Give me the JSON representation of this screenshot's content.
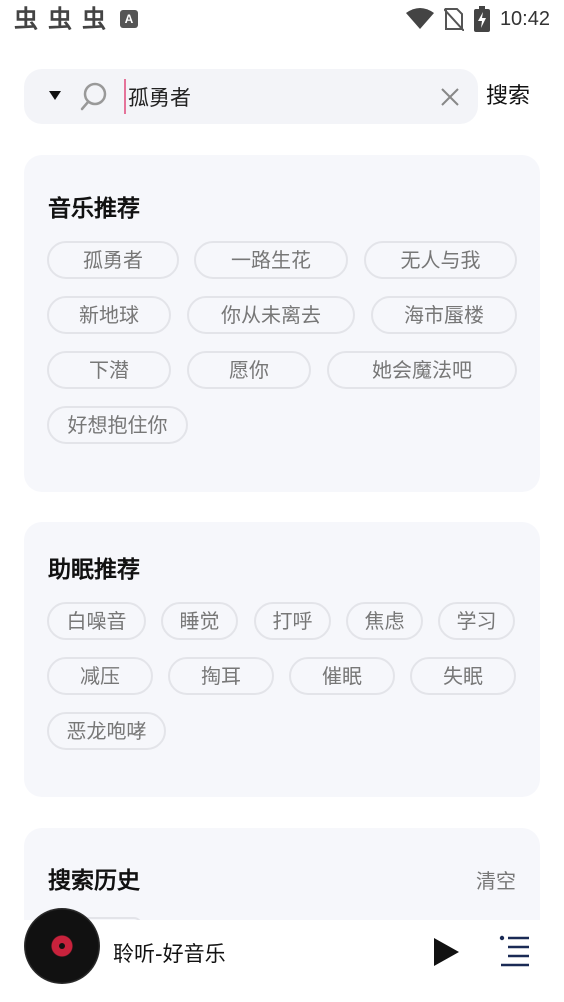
{
  "status_bar": {
    "time": "10:42",
    "left_icons": [
      "bug-icon",
      "bug-icon",
      "bug-icon",
      "a-badge-icon"
    ],
    "a_badge": "A",
    "right_icons": [
      "wifi-icon",
      "no-sim-icon",
      "battery-charging-icon"
    ]
  },
  "search": {
    "value": "孤勇者",
    "button_label": "搜索"
  },
  "music": {
    "title": "音乐推荐",
    "tags": [
      "孤勇者",
      "一路生花",
      "无人与我",
      "新地球",
      "你从未离去",
      "海市蜃楼",
      "下潜",
      "愿你",
      "她会魔法吧",
      "好想抱住你"
    ]
  },
  "sleep": {
    "title": "助眠推荐",
    "tags": [
      "白噪音",
      "睡觉",
      "打呼",
      "焦虑",
      "学习",
      "减压",
      "掏耳",
      "催眠",
      "失眠",
      "恶龙咆哮"
    ]
  },
  "history": {
    "title": "搜索历史",
    "clear_label": "清空"
  },
  "player": {
    "title": "聆听-好音乐"
  },
  "colors": {
    "accent_disc": "#c8223c",
    "card_bg": "#f6f7fb",
    "search_bg": "#f3f4f8"
  }
}
